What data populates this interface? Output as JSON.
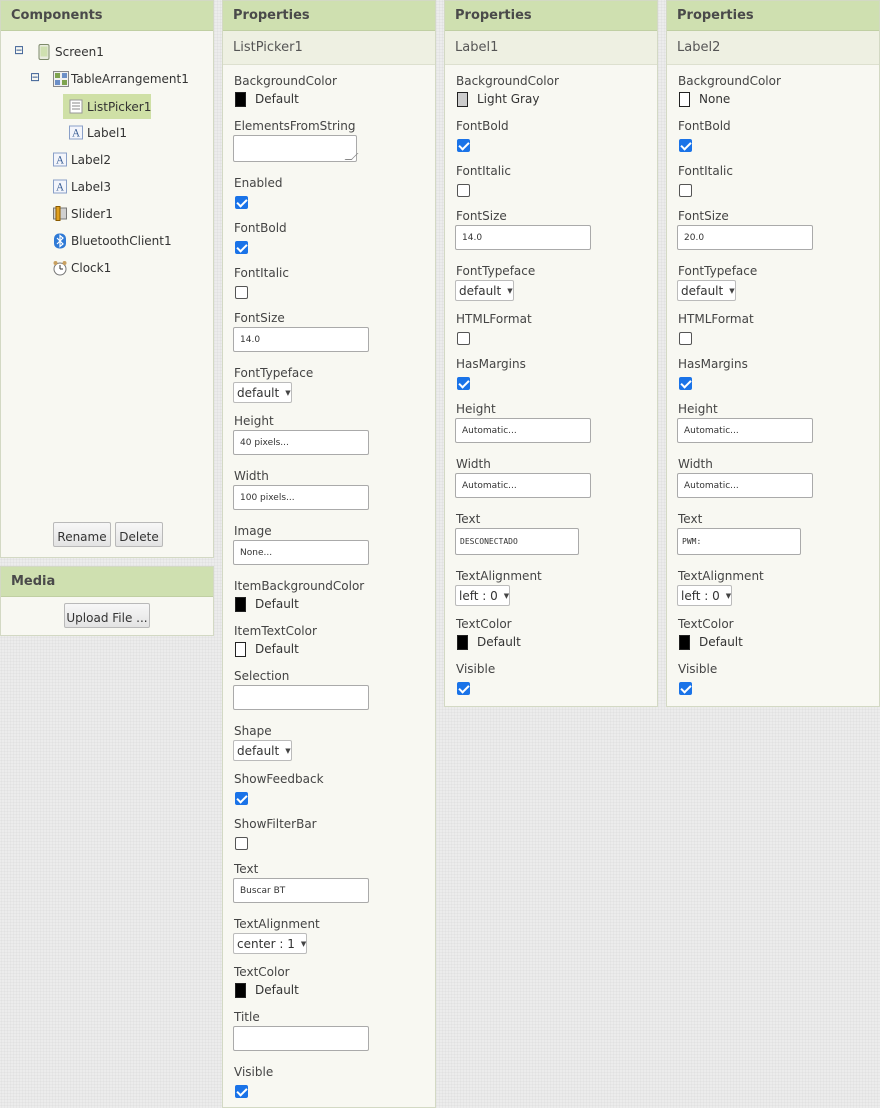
{
  "components": {
    "title": "Components",
    "tree": [
      {
        "label": "Screen1",
        "icon": "screen-icon"
      },
      {
        "label": "TableArrangement1",
        "icon": "table-arrangement-icon"
      },
      {
        "label": "ListPicker1",
        "icon": "listpicker-icon"
      },
      {
        "label": "Label1",
        "icon": "label-icon"
      },
      {
        "label": "Label2",
        "icon": "label-icon"
      },
      {
        "label": "Label3",
        "icon": "label-icon"
      },
      {
        "label": "Slider1",
        "icon": "slider-icon"
      },
      {
        "label": "BluetoothClient1",
        "icon": "bluetooth-icon"
      },
      {
        "label": "Clock1",
        "icon": "clock-icon"
      }
    ],
    "collapse_glyph": "⊟",
    "rename_label": "Rename",
    "delete_label": "Delete"
  },
  "media": {
    "title": "Media",
    "upload_label": "Upload File ..."
  },
  "listpicker_panel": {
    "title": "Properties",
    "component": "ListPicker1",
    "background_color": {
      "label": "BackgroundColor",
      "value": "Default",
      "color": "#000000"
    },
    "elements_from_string": {
      "label": "ElementsFromString",
      "value": ""
    },
    "enabled": {
      "label": "Enabled",
      "checked": true
    },
    "font_bold": {
      "label": "FontBold",
      "checked": true
    },
    "font_italic": {
      "label": "FontItalic",
      "checked": false
    },
    "font_size": {
      "label": "FontSize",
      "value": "14.0"
    },
    "font_typeface": {
      "label": "FontTypeface",
      "value": "default"
    },
    "height": {
      "label": "Height",
      "value": "40 pixels..."
    },
    "width": {
      "label": "Width",
      "value": "100 pixels..."
    },
    "image": {
      "label": "Image",
      "value": "None..."
    },
    "item_background_color": {
      "label": "ItemBackgroundColor",
      "value": "Default",
      "color": "#000000"
    },
    "item_text_color": {
      "label": "ItemTextColor",
      "value": "Default",
      "color": "#ffffff"
    },
    "selection": {
      "label": "Selection",
      "value": ""
    },
    "shape": {
      "label": "Shape",
      "value": "default"
    },
    "show_feedback": {
      "label": "ShowFeedback",
      "checked": true
    },
    "show_filter_bar": {
      "label": "ShowFilterBar",
      "checked": false
    },
    "text": {
      "label": "Text",
      "value": "Buscar BT"
    },
    "text_alignment": {
      "label": "TextAlignment",
      "value": "center : 1"
    },
    "text_color": {
      "label": "TextColor",
      "value": "Default",
      "color": "#000000"
    },
    "title_prop": {
      "label": "Title",
      "value": ""
    },
    "visible": {
      "label": "Visible",
      "checked": true
    }
  },
  "label1_panel": {
    "title": "Properties",
    "component": "Label1",
    "background_color": {
      "label": "BackgroundColor",
      "value": "Light Gray",
      "color": "#cccccc"
    },
    "font_bold": {
      "label": "FontBold",
      "checked": true
    },
    "font_italic": {
      "label": "FontItalic",
      "checked": false
    },
    "font_size": {
      "label": "FontSize",
      "value": "14.0"
    },
    "font_typeface": {
      "label": "FontTypeface",
      "value": "default"
    },
    "html_format": {
      "label": "HTMLFormat",
      "checked": false
    },
    "has_margins": {
      "label": "HasMargins",
      "checked": true
    },
    "height": {
      "label": "Height",
      "value": "Automatic..."
    },
    "width": {
      "label": "Width",
      "value": "Automatic..."
    },
    "text": {
      "label": "Text",
      "value": "DESCONECTADO"
    },
    "text_alignment": {
      "label": "TextAlignment",
      "value": "left : 0"
    },
    "text_color": {
      "label": "TextColor",
      "value": "Default",
      "color": "#000000"
    },
    "visible": {
      "label": "Visible",
      "checked": true
    }
  },
  "label2_panel": {
    "title": "Properties",
    "component": "Label2",
    "background_color": {
      "label": "BackgroundColor",
      "value": "None",
      "color": "#ffffff"
    },
    "font_bold": {
      "label": "FontBold",
      "checked": true
    },
    "font_italic": {
      "label": "FontItalic",
      "checked": false
    },
    "font_size": {
      "label": "FontSize",
      "value": "20.0"
    },
    "font_typeface": {
      "label": "FontTypeface",
      "value": "default"
    },
    "html_format": {
      "label": "HTMLFormat",
      "checked": false
    },
    "has_margins": {
      "label": "HasMargins",
      "checked": true
    },
    "height": {
      "label": "Height",
      "value": "Automatic..."
    },
    "width": {
      "label": "Width",
      "value": "Automatic..."
    },
    "text": {
      "label": "Text",
      "value": "PWM:"
    },
    "text_alignment": {
      "label": "TextAlignment",
      "value": "left : 0"
    },
    "text_color": {
      "label": "TextColor",
      "value": "Default",
      "color": "#000000"
    },
    "visible": {
      "label": "Visible",
      "checked": true
    }
  },
  "dropdown_caret": "▼"
}
